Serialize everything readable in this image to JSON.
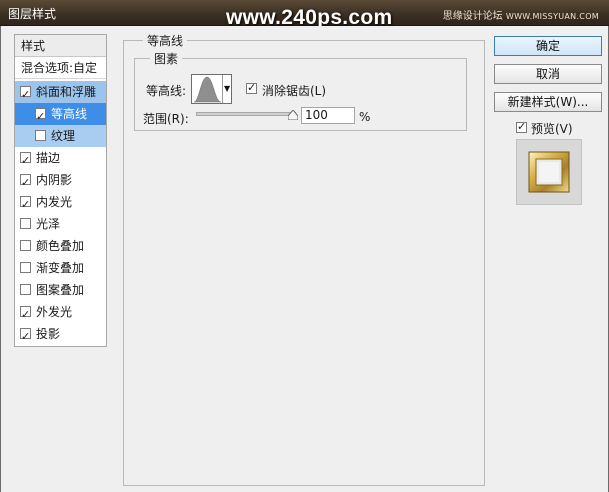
{
  "window": {
    "title": "图层样式",
    "watermark_main": "www.240ps.com",
    "watermark_right_cn": "思缘设计论坛",
    "watermark_right_en": "WWW.MISSYUAN.COM"
  },
  "styles_panel": {
    "header": "样式",
    "blend_options": "混合选项:自定",
    "items": [
      {
        "label": "斜面和浮雕",
        "checked": true
      },
      {
        "label": "等高线",
        "checked": true
      },
      {
        "label": "纹理",
        "checked": false
      },
      {
        "label": "描边",
        "checked": true
      },
      {
        "label": "内阴影",
        "checked": true
      },
      {
        "label": "内发光",
        "checked": true
      },
      {
        "label": "光泽",
        "checked": false
      },
      {
        "label": "颜色叠加",
        "checked": false
      },
      {
        "label": "渐变叠加",
        "checked": false
      },
      {
        "label": "图案叠加",
        "checked": false
      },
      {
        "label": "外发光",
        "checked": true
      },
      {
        "label": "投影",
        "checked": true
      }
    ]
  },
  "contour_section": {
    "group_title": "等高线",
    "subgroup_title": "图素",
    "contour_label": "等高线:",
    "anti_alias_label": "消除锯齿(L)",
    "anti_alias_checked": true,
    "range_label": "范围(R):",
    "range_value": "100",
    "range_unit": "%"
  },
  "buttons": {
    "ok": "确定",
    "cancel": "取消",
    "new_style": "新建样式(W)...",
    "preview_label": "预览(V)",
    "preview_checked": true
  },
  "colors": {
    "titlebar": "#3b3024",
    "selection": "#3e8de6",
    "selection_light": "#9bc4ec"
  }
}
